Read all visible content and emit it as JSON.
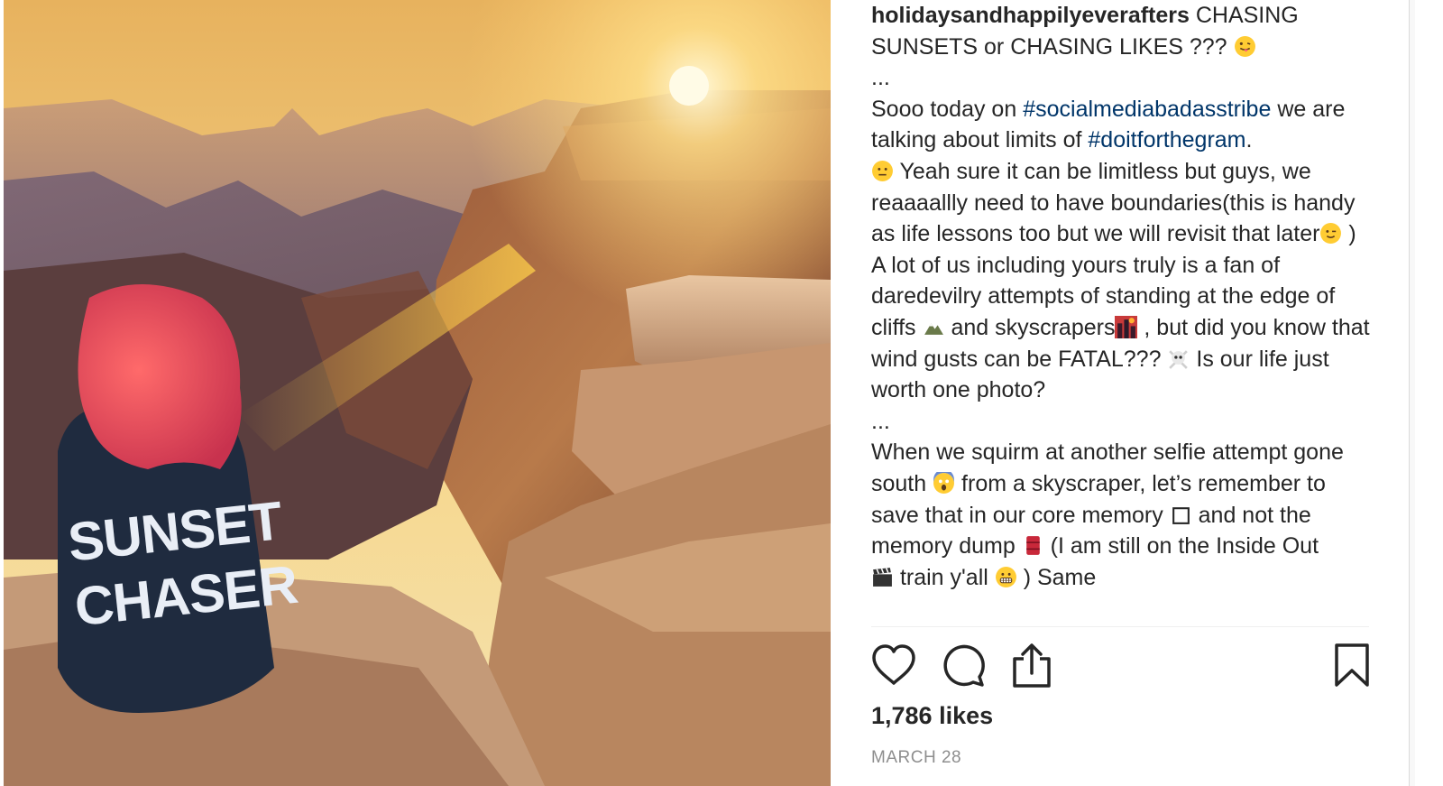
{
  "post": {
    "username": "holidaysandhappilyeverafters",
    "caption_title": " CHASING SUNSETS or CHASING LIKES ??? ",
    "ellipsis_1": "...",
    "line_sooo": "Sooo today on ",
    "hashtag_1": "#socialmediabadasstribe",
    "line_we_are": " we are talking about limits of ",
    "hashtag_2": "#doitforthegram",
    "period": ".",
    "line_yeah": " Yeah sure it can be limitless but guys, we reaaaallly need to have boundaries(this is handy as life lessons too but we will revisit that later",
    "line_yeah_end": " )",
    "para_a_lot": "A lot of us including yours truly is a fan of daredevilry attempts of standing at the edge of cliffs ",
    "para_and_sky": " and skyscrapers",
    "para_but": " , but did you know that wind gusts can be FATAL??? ",
    "para_is": "  Is our life just worth one photo?",
    "ellipsis_2": "...",
    "para_when": "When we squirm at another selfie attempt gone south ",
    "para_from": "  from a skyscraper, let’s remember to save that in our core memory ",
    "para_and_not": " and not the memory dump ",
    "para_iam": "  (I am still on the Inside Out ",
    "para_train": "  train y'all ",
    "para_same": "  ) Same",
    "likes": "1,786 likes",
    "date": "MARCH 28"
  },
  "photo": {
    "shirt_line_1": "SUNSET",
    "shirt_line_2": "CHASER"
  },
  "icons": [
    "heart-icon",
    "comment-icon",
    "share-icon",
    "bookmark-icon"
  ],
  "colors": {
    "text": "#262626",
    "hashtag": "#003569",
    "muted": "#8e8e8e",
    "sky_top": "#f2c86a",
    "hair": "#e24b5d"
  }
}
